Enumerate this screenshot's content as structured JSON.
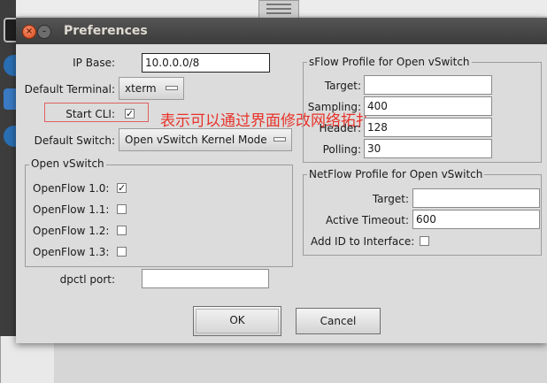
{
  "window": {
    "title": "Preferences"
  },
  "fields": {
    "ip_base_label": "IP Base:",
    "ip_base_value": "10.0.0.0/8",
    "default_terminal_label": "Default Terminal:",
    "default_terminal_value": "xterm",
    "start_cli_label": "Start CLI:",
    "default_switch_label": "Default Switch:",
    "default_switch_value": "Open vSwitch Kernel Mode",
    "dpctl_port_label": "dpctl port:",
    "dpctl_port_value": ""
  },
  "checkbox_glyph": "✓",
  "openvswitch": {
    "title": "Open vSwitch",
    "items": [
      {
        "label": "OpenFlow 1.0:",
        "checked": true
      },
      {
        "label": "OpenFlow 1.1:",
        "checked": false
      },
      {
        "label": "OpenFlow 1.2:",
        "checked": false
      },
      {
        "label": "OpenFlow 1.3:",
        "checked": false
      }
    ]
  },
  "sflow": {
    "title": "sFlow Profile for Open vSwitch",
    "target_label": "Target:",
    "target_value": "",
    "sampling_label": "Sampling:",
    "sampling_value": "400",
    "header_label": "Header:",
    "header_value": "128",
    "polling_label": "Polling:",
    "polling_value": "30"
  },
  "netflow": {
    "title": "NetFlow Profile for Open vSwitch",
    "target_label": "Target:",
    "target_value": "",
    "timeout_label": "Active Timeout:",
    "timeout_value": "600",
    "addid_label": "Add ID to Interface:"
  },
  "buttons": {
    "ok": "OK",
    "cancel": "Cancel"
  },
  "annotation": {
    "text": "表示可以通过界面修改网络拓扑",
    "color": "#e8332a"
  }
}
